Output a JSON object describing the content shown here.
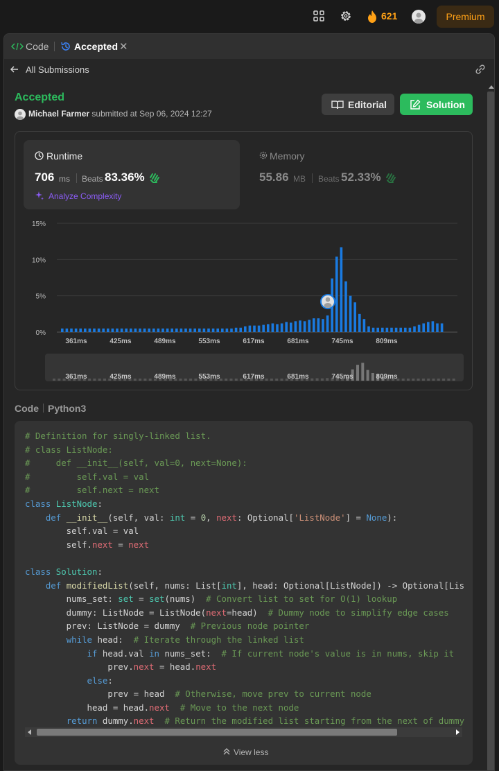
{
  "topbar": {
    "streak": "621",
    "premium_label": "Premium",
    "icons": [
      "layout-icon",
      "gear-icon",
      "fire-icon",
      "avatar"
    ]
  },
  "tabs": {
    "code_label": "Code",
    "accepted_label": "Accepted"
  },
  "subbar": {
    "all_submissions": "All Submissions"
  },
  "submission": {
    "status": "Accepted",
    "author": "Michael Farmer",
    "submitted_text": "submitted at Sep 06, 2024 12:27",
    "editorial_label": "Editorial",
    "solution_label": "Solution"
  },
  "runtime": {
    "label": "Runtime",
    "value": "706",
    "unit": "ms",
    "beats_label": "Beats",
    "beats_pct": "83.36%",
    "analyze_label": "Analyze Complexity"
  },
  "memory": {
    "label": "Memory",
    "value": "55.86",
    "unit": "MB",
    "beats_label": "Beats",
    "beats_pct": "52.33%"
  },
  "colors": {
    "accent_green": "#2cbb5d",
    "bar_blue": "#1a7ae0",
    "premium_orange": "#ffa116",
    "analyze_purple": "#8b5cf6"
  },
  "chart_data": {
    "type": "bar",
    "y_ticks": [
      "15%",
      "10%",
      "5%",
      "0%"
    ],
    "ylim": [
      0,
      15
    ],
    "x_ticks": [
      "361ms",
      "425ms",
      "489ms",
      "553ms",
      "617ms",
      "681ms",
      "745ms",
      "809ms"
    ],
    "values": [
      0.5,
      0.5,
      0.5,
      0.5,
      0.5,
      0.5,
      0.5,
      0.5,
      0.5,
      0.5,
      0.5,
      0.5,
      0.5,
      0.5,
      0.5,
      0.5,
      0.5,
      0.5,
      0.5,
      0.5,
      0.5,
      0.5,
      0.5,
      0.5,
      0.5,
      0.5,
      0.5,
      0.5,
      0.5,
      0.5,
      0.5,
      0.5,
      0.5,
      0.5,
      0.5,
      0.5,
      0.5,
      0.5,
      0.6,
      0.6,
      0.8,
      0.9,
      0.9,
      0.9,
      1.0,
      1.1,
      1.2,
      1.1,
      1.2,
      1.4,
      1.3,
      1.5,
      1.6,
      1.5,
      1.7,
      1.9,
      1.9,
      1.8,
      2.3,
      7.4,
      10.4,
      11.7,
      7.0,
      5.0,
      4.1,
      2.5,
      1.8,
      0.8,
      0.6,
      0.6,
      0.6,
      0.6,
      0.6,
      0.6,
      0.6,
      0.6,
      0.6,
      0.8,
      1.0,
      1.2,
      1.4,
      1.5,
      1.2,
      1.2
    ],
    "highlight_value": "706ms"
  },
  "code": {
    "header_label": "Code",
    "language": "Python3",
    "view_less_label": "View less"
  }
}
